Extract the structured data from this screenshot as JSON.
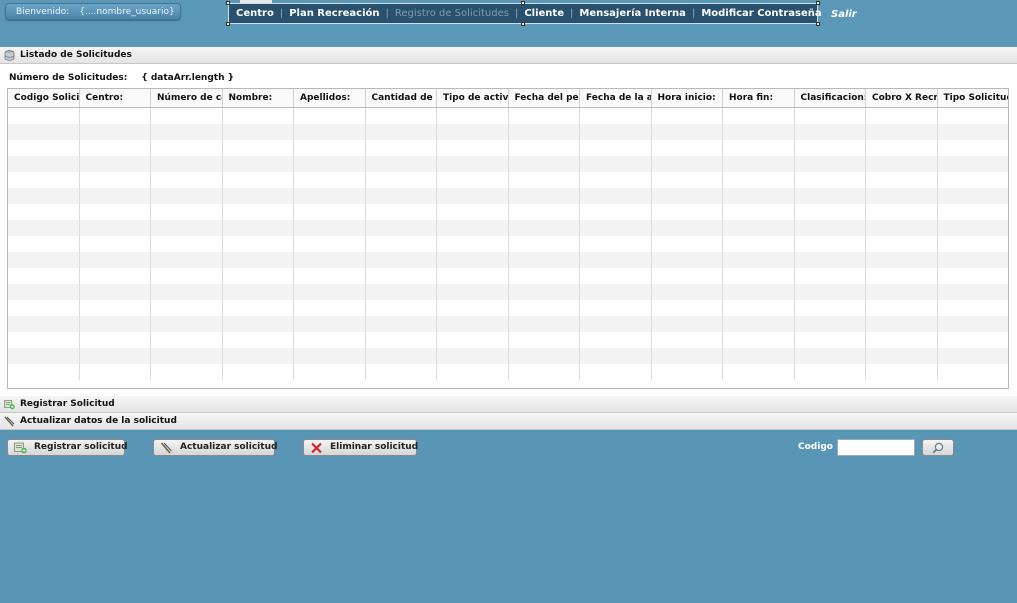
{
  "header": {
    "welcome_label": "Bienvenido:",
    "user_name": "{....nombre_usuario}",
    "nav": [
      {
        "label": "Centro",
        "disabled": false
      },
      {
        "label": "Plan Recreación",
        "disabled": false
      },
      {
        "label": "Registro de Solicitudes",
        "disabled": true
      },
      {
        "label": "Cliente",
        "disabled": false
      },
      {
        "label": "Mensajería Interna",
        "disabled": false
      },
      {
        "label": "Modificar Contraseña",
        "disabled": false
      }
    ],
    "logout_label": "Salir"
  },
  "listado": {
    "title": "Listado de Solicitudes",
    "count_label": "Número de Solicitudes:",
    "count_value": "{ dataArr.length }"
  },
  "grid": {
    "columns": [
      "Codigo Solicitud:",
      "Centro:",
      "Número de cargo:",
      "Nombre:",
      "Apellidos:",
      "Cantidad de personas:",
      "Tipo de actividad:",
      "Fecha del pedido:",
      "Fecha de la actividad:",
      "Hora inicio:",
      "Hora fin:",
      "Clasificacion:",
      "Cobro X Recreacion:",
      "Tipo Solicitud:"
    ],
    "empty_rows": 17
  },
  "sections": {
    "registrar": "Registrar Solicitud",
    "actualizar": "Actualizar datos de la solicitud"
  },
  "actions": {
    "registrar": "Registrar solicitud",
    "actualizar": "Actualizar solicitud",
    "eliminar": "Eliminar solicitud"
  },
  "search": {
    "codigo_label": "Codigo",
    "codigo_value": ""
  },
  "colors": {
    "background": "#5996b6",
    "nav_bar": "#29506c",
    "panel": "#ffffff"
  }
}
